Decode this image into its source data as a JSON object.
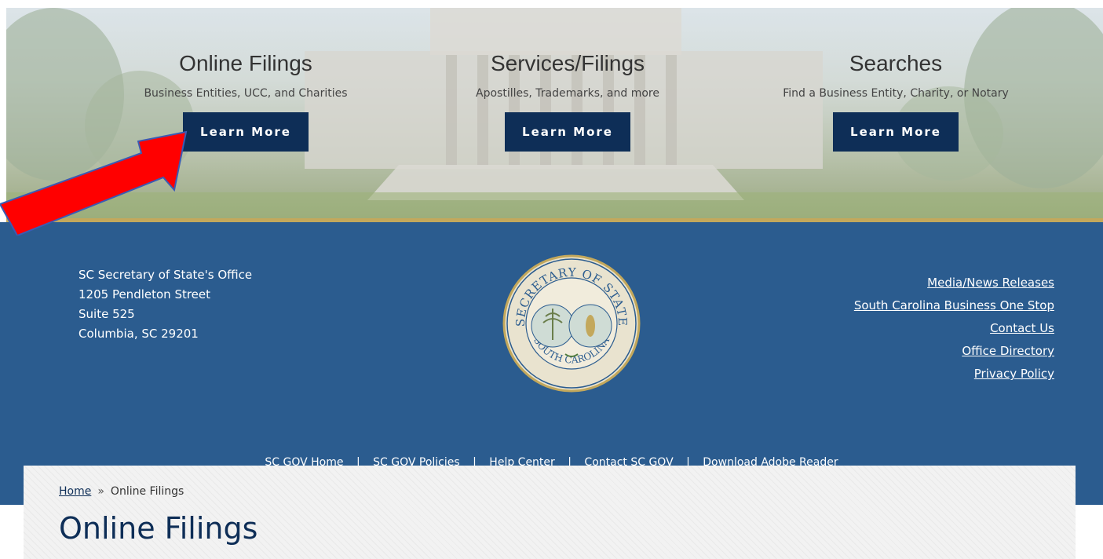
{
  "hero": {
    "columns": [
      {
        "title": "Online Filings",
        "subtitle": "Business Entities, UCC, and Charities",
        "button": "Learn More"
      },
      {
        "title": "Services/Filings",
        "subtitle": "Apostilles, Trademarks, and more",
        "button": "Learn More"
      },
      {
        "title": "Searches",
        "subtitle": "Find a Business Entity, Charity, or Notary",
        "button": "Learn More"
      }
    ]
  },
  "footer": {
    "address": [
      "SC Secretary of State's Office",
      "1205 Pendleton Street",
      "Suite 525",
      "Columbia, SC 29201"
    ],
    "links": [
      "Media/News Releases",
      "South Carolina Business One Stop",
      "Contact Us",
      "Office Directory",
      "Privacy Policy"
    ],
    "seal": {
      "top_text": "SECRETARY OF STATE",
      "bottom_text": "SOUTH CAROLINA"
    },
    "bottom_links": [
      "SC GOV Home",
      "SC GOV Policies",
      "Help Center",
      "Contact SC GOV",
      "Download Adobe Reader"
    ],
    "separator": "|"
  },
  "breadcrumb": {
    "home": "Home",
    "separator": "»",
    "current": "Online Filings"
  },
  "page_title": "Online Filings",
  "colors": {
    "navy": "#0e2e57",
    "footer_blue": "#2b5c8f",
    "gold": "#c3a85c",
    "arrow_red": "#ff0000"
  },
  "annotation": {
    "type": "red-arrow",
    "points_to": "hero.columns.0.button"
  }
}
